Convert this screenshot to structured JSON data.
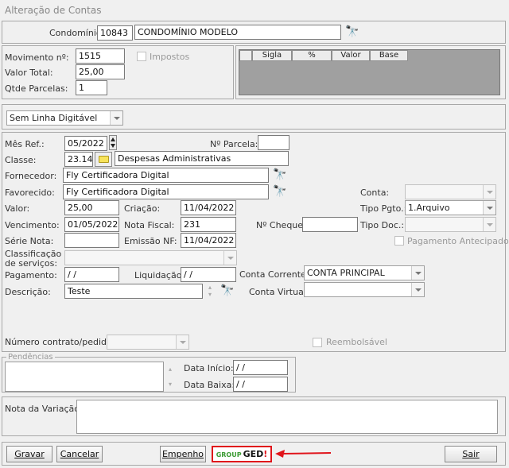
{
  "window": {
    "title": "Alteração de Contas"
  },
  "header": {
    "condominio_label": "Condomínio:",
    "condominio_code": "10843",
    "condominio_name": "CONDOMÍNIO MODELO"
  },
  "movement": {
    "movimento_label": "Movimento nº:",
    "movimento_value": "1515",
    "valor_total_label": "Valor Total:",
    "valor_total_value": "25,00",
    "qtde_parcelas_label": "Qtde Parcelas:",
    "qtde_parcelas_value": "1",
    "impostos_label": "Impostos"
  },
  "tax_grid": {
    "columns": [
      "Sigla",
      "%",
      "Valor",
      "Base"
    ]
  },
  "linha_digitavel": {
    "selected": "Sem Linha Digitável"
  },
  "form": {
    "mes_ref_label": "Mês Ref.:",
    "mes_ref_value": "05/2022",
    "parcela_label": "Nº Parcela:",
    "parcela_value": "",
    "classe_label": "Classe:",
    "classe_code": "23.14",
    "classe_desc": "Despesas Administrativas",
    "fornecedor_label": "Fornecedor:",
    "fornecedor_value": "Fly Certificadora Digital",
    "favorecido_label": "Favorecido:",
    "favorecido_value": "Fly Certificadora Digital",
    "conta_label": "Conta:",
    "conta_value": "",
    "valor_label": "Valor:",
    "valor_value": "25,00",
    "criacao_label": "Criação:",
    "criacao_value": "11/04/2022",
    "tipo_pgto_label": "Tipo Pgto.:",
    "tipo_pgto_value": "1.Arquivo",
    "vencimento_label": "Vencimento:",
    "vencimento_value": "01/05/2022",
    "nota_fiscal_label": "Nota Fiscal:",
    "nota_fiscal_value": "231",
    "cheque_label": "Nº Cheque:",
    "cheque_value": "",
    "tipo_doc_label": "Tipo Doc.:",
    "tipo_doc_value": "",
    "serie_nota_label": "Série Nota:",
    "serie_nota_value": "",
    "emissao_nf_label": "Emissão NF:",
    "emissao_nf_value": "11/04/2022",
    "pagamento_antecipado_label": "Pagamento Antecipado",
    "classificacao_label_1": "Classificação",
    "classificacao_label_2": "de serviços:",
    "classificacao_value": "",
    "pagamento_label": "Pagamento:",
    "pagamento_value": " / /",
    "liquidacao_label": "Liquidação:",
    "liquidacao_value": " / /",
    "conta_corrente_label": "Conta Corrente:",
    "conta_corrente_value": "CONTA PRINCIPAL",
    "descricao_label": "Descrição:",
    "descricao_value": "Teste",
    "conta_virtual_label": "Conta Virtual:",
    "conta_virtual_value": "",
    "numero_contrato_label": "Número contrato/pedido:",
    "numero_contrato_value": "",
    "reembolsavel_label": "Reembolsável"
  },
  "pendencias": {
    "title": "Pendências",
    "data_inicio_label": "Data Início:",
    "data_inicio_value": " / /",
    "data_baixa_label": "Data Baixa:",
    "data_baixa_value": " / /"
  },
  "nota": {
    "label": "Nota da Variação:",
    "value": ""
  },
  "footer": {
    "gravar": "Gravar",
    "cancelar": "Cancelar",
    "empenho": "Empenho",
    "ged_group": "GROUP",
    "ged_text": "GED",
    "ged_mark": "!",
    "sair": "Sair",
    "accent": "#e0141b",
    "ged_green": "#3d9b35"
  },
  "icons": {
    "search": "binoculars-icon",
    "folder": "folder-icon"
  }
}
